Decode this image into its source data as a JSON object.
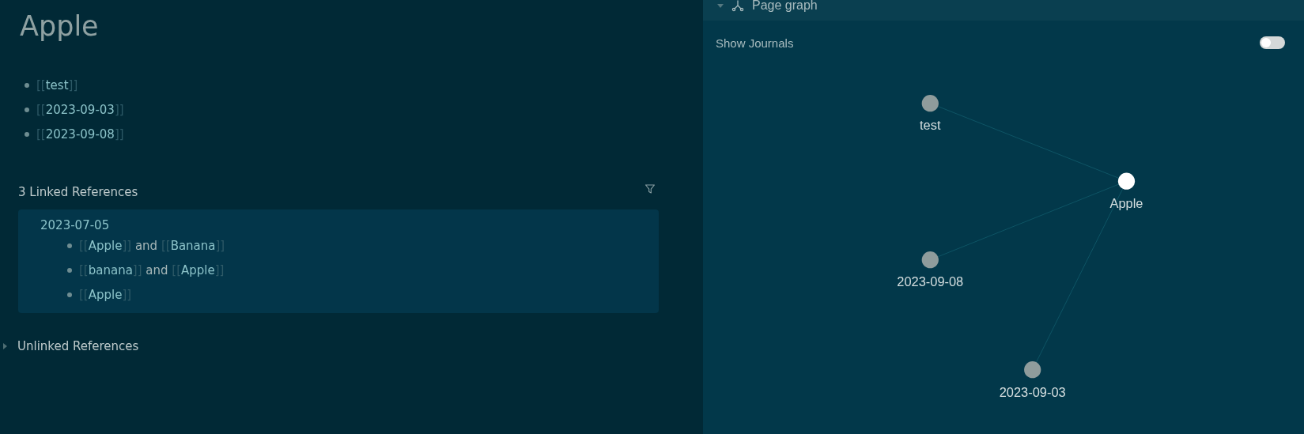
{
  "page": {
    "title": "Apple",
    "blocks": [
      [
        {
          "kind": "link",
          "open": "[[",
          "text": "test",
          "close": "]]"
        }
      ],
      [
        {
          "kind": "link",
          "open": "[[",
          "text": "2023-09-03",
          "close": "]]"
        }
      ],
      [
        {
          "kind": "link",
          "open": "[[",
          "text": "2023-09-08",
          "close": "]]"
        }
      ]
    ]
  },
  "linked_references": {
    "title": "3 Linked References",
    "groups": [
      {
        "date": "2023-07-05",
        "blocks": [
          [
            {
              "kind": "link",
              "open": "[[",
              "text": "Apple",
              "close": "]]"
            },
            {
              "kind": "text",
              "text": " and "
            },
            {
              "kind": "link",
              "open": "[[",
              "text": "Banana",
              "close": "]]"
            }
          ],
          [
            {
              "kind": "link",
              "open": "[[",
              "text": "banana",
              "close": "]]"
            },
            {
              "kind": "text",
              "text": " and "
            },
            {
              "kind": "link",
              "open": "[[",
              "text": "Apple",
              "close": "]]"
            }
          ],
          [
            {
              "kind": "link",
              "open": "[[",
              "text": "Apple",
              "close": "]]"
            }
          ]
        ]
      }
    ]
  },
  "unlinked_references": {
    "title": "Unlinked References",
    "expanded": false
  },
  "graph_panel": {
    "title": "Page graph",
    "expanded": true,
    "show_journals": {
      "label": "Show Journals",
      "on": false
    },
    "nodes": [
      {
        "label": "test",
        "current": false
      },
      {
        "label": "Apple",
        "current": true
      },
      {
        "label": "2023-09-08",
        "current": false
      },
      {
        "label": "2023-09-03",
        "current": false
      }
    ]
  }
}
